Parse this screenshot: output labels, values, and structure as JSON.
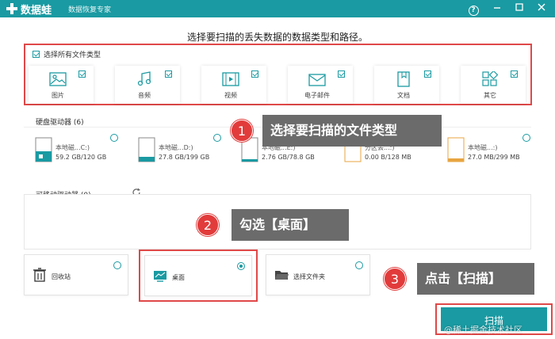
{
  "app": {
    "name": "数据蛙",
    "subtitle": "数据恢复专家"
  },
  "instruction": "选择要扫描的丢失数据的数据类型和路径。",
  "file_types": {
    "select_all_label": "选择所有文件类型",
    "items": [
      {
        "label": "图片",
        "icon": "image-icon"
      },
      {
        "label": "音频",
        "icon": "music-icon"
      },
      {
        "label": "视频",
        "icon": "video-icon"
      },
      {
        "label": "电子邮件",
        "icon": "email-icon"
      },
      {
        "label": "文档",
        "icon": "document-icon"
      },
      {
        "label": "其它",
        "icon": "other-icon"
      }
    ]
  },
  "hard_drives": {
    "label": "硬盘驱动器 (6)",
    "items": [
      {
        "name": "本地磁...C:)",
        "size": "59.2 GB/120 GB"
      },
      {
        "name": "本地磁...D:)",
        "size": "27.8 GB/199 GB"
      },
      {
        "name": "本地磁...E:)",
        "size": "2.76 GB/78.8 GB"
      },
      {
        "name": "分区丢...:)",
        "size": "0.00  B/128 MB"
      },
      {
        "name": "本地磁...:)",
        "size": "27.0 MB/299 MB"
      }
    ]
  },
  "removable": {
    "label": "可移动驱动器 (0)"
  },
  "locations": {
    "recycle": "回收站",
    "desktop": "桌面",
    "folder": "选择文件夹"
  },
  "scan_label": "扫描",
  "callouts": {
    "step1": {
      "num": "1",
      "text": "选择要扫描的文件类型"
    },
    "step2": {
      "num": "2",
      "text": "勾选【桌面】"
    },
    "step3": {
      "num": "3",
      "text": "点击【扫描】"
    }
  },
  "watermark": "@稀土掘金技术社区",
  "colors": {
    "accent": "#1a9aa2",
    "highlight": "#e04848",
    "callout_bg": "#6b6b6b"
  }
}
